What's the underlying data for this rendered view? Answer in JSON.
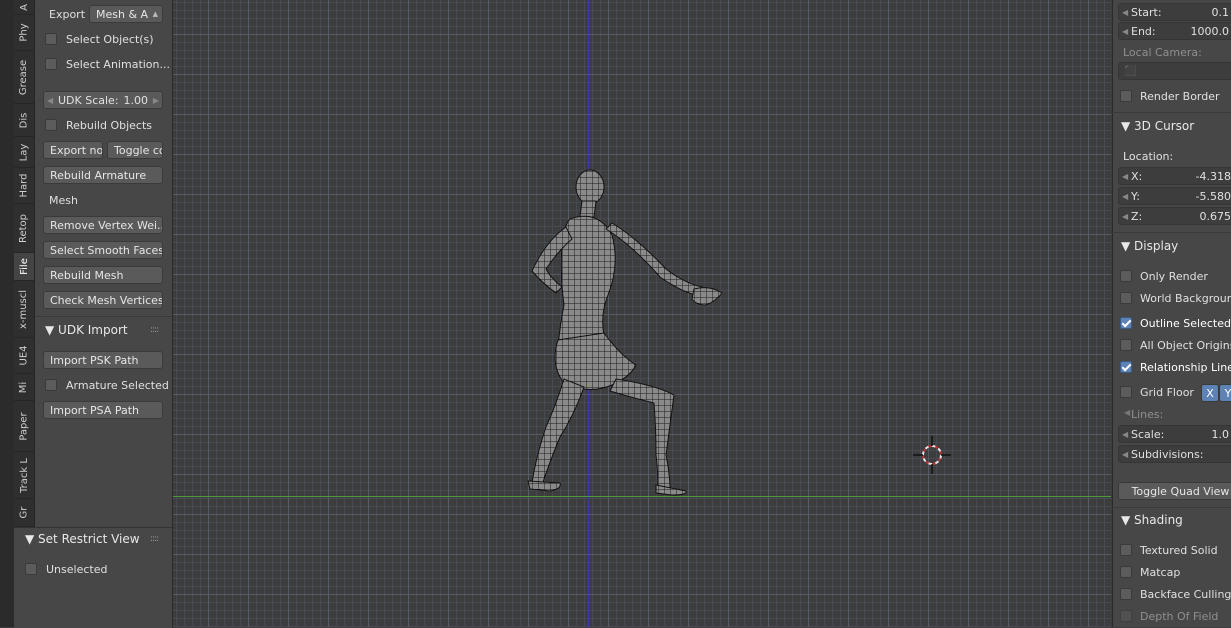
{
  "tabs": [
    "A",
    "Phy",
    "Grease",
    "Dis",
    "Lay",
    "Hard",
    "Retop",
    "File",
    "x-muscl",
    "UE4",
    "Mi",
    "Paper",
    "Track L",
    "Gr"
  ],
  "tool_panel": {
    "export_label": "Export",
    "export_value": "Mesh & A",
    "select_objects": "Select Object(s)",
    "select_animation": "Select Animation...",
    "udk_scale_label": "UDK Scale:",
    "udk_scale_value": "1.00",
    "rebuild_objects": "Rebuild Objects",
    "export_no": "Export no",
    "toggle_co": "Toggle co",
    "rebuild_armature": "Rebuild Armature",
    "mesh_label": "Mesh",
    "remove_vertex": "Remove Vertex Wei...",
    "select_smooth": "Select Smooth Faces",
    "rebuild_mesh": "Rebuild Mesh",
    "check_mesh": "Check Mesh Vertices",
    "udk_import_header": "UDK Import",
    "import_psk": "Import PSK Path",
    "armature_selected": "Armature Selected",
    "import_psa": "Import PSA Path"
  },
  "restrict_panel": {
    "header": "Set Restrict View",
    "unselected": "Unselected"
  },
  "props_panel": {
    "start_label": "Start:",
    "start_value": "0.1",
    "end_label": "End:",
    "end_value": "1000.0",
    "local_camera": "Local Camera:",
    "render_border": "Render Border",
    "cursor_header": "3D Cursor",
    "location": "Location:",
    "x_label": "X:",
    "x_value": "-4.318",
    "y_label": "Y:",
    "y_value": "-5.580",
    "z_label": "Z:",
    "z_value": "0.675",
    "display_header": "Display",
    "only_render": "Only Render",
    "world_background": "World Background",
    "outline_selected": "Outline Selected",
    "all_object_origins": "All Object Origins",
    "relationship_lines": "Relationship Lines",
    "grid_floor": "Grid Floor",
    "grid_x": "X",
    "grid_y": "Y",
    "lines": "Lines:",
    "scale_label": "Scale:",
    "scale_value": "1.0",
    "subdivisions": "Subdivisions:",
    "toggle_quad": "Toggle Quad View",
    "shading_header": "Shading",
    "textured_solid": "Textured Solid",
    "matcap": "Matcap",
    "backface_culling": "Backface Culling",
    "depth_of_field": "Depth Of Field"
  }
}
